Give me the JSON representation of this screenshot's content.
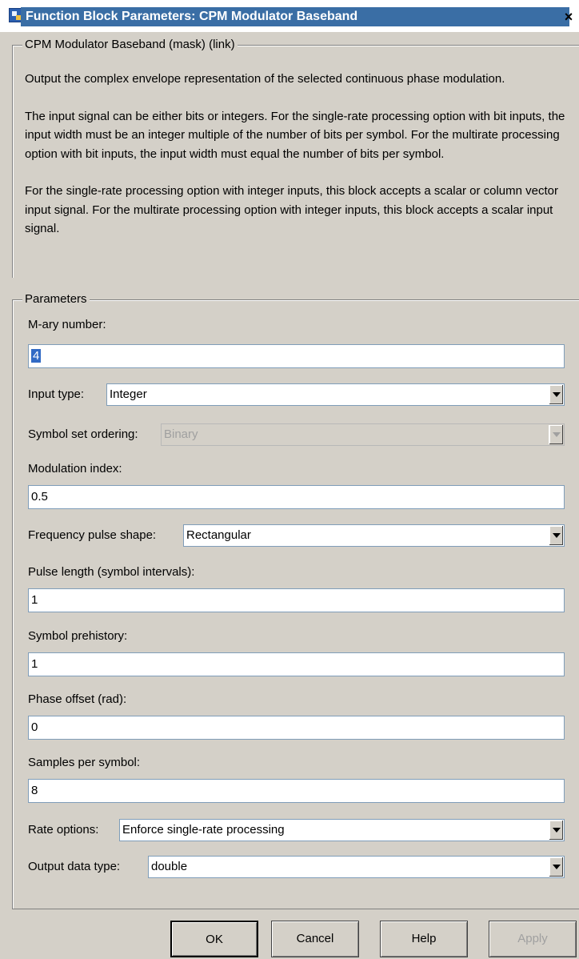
{
  "window": {
    "title": "Function Block Parameters: CPM Modulator Baseband",
    "close_label": "×",
    "app_icon": "simulink-block-icon"
  },
  "description": {
    "legend": "CPM Modulator Baseband (mask) (link)",
    "paragraphs": [
      "Output the complex envelope representation of the selected continuous phase modulation.",
      "The input signal can be either bits or integers.  For the single-rate processing option with bit inputs, the input width must be an integer multiple of the number of bits per symbol.  For the multirate processing option with bit inputs, the input width must equal the number of bits per symbol.",
      "For the single-rate processing option with integer inputs, this block accepts a scalar or column vector input signal.  For the multirate processing option with integer inputs, this block accepts a scalar input signal."
    ]
  },
  "parameters": {
    "legend": "Parameters",
    "mary_label": "M-ary number:",
    "mary_value": "4",
    "input_type_label": "Input type:",
    "input_type_value": "Integer",
    "symbol_ordering_label": "Symbol set ordering:",
    "symbol_ordering_value": "Binary",
    "mod_index_label": "Modulation index:",
    "mod_index_value": "0.5",
    "freq_pulse_label": "Frequency pulse shape:",
    "freq_pulse_value": "Rectangular",
    "pulse_length_label": "Pulse length (symbol intervals):",
    "pulse_length_value": "1",
    "prehistory_label": "Symbol prehistory:",
    "prehistory_value": "1",
    "phase_offset_label": "Phase offset (rad):",
    "phase_offset_value": "0",
    "samples_label": "Samples per symbol:",
    "samples_value": "8",
    "rate_label": "Rate options:",
    "rate_value": "Enforce single-rate processing",
    "output_type_label": "Output data type:",
    "output_type_value": "double"
  },
  "buttons": {
    "ok": "OK",
    "cancel": "Cancel",
    "help": "Help",
    "apply": "Apply"
  }
}
